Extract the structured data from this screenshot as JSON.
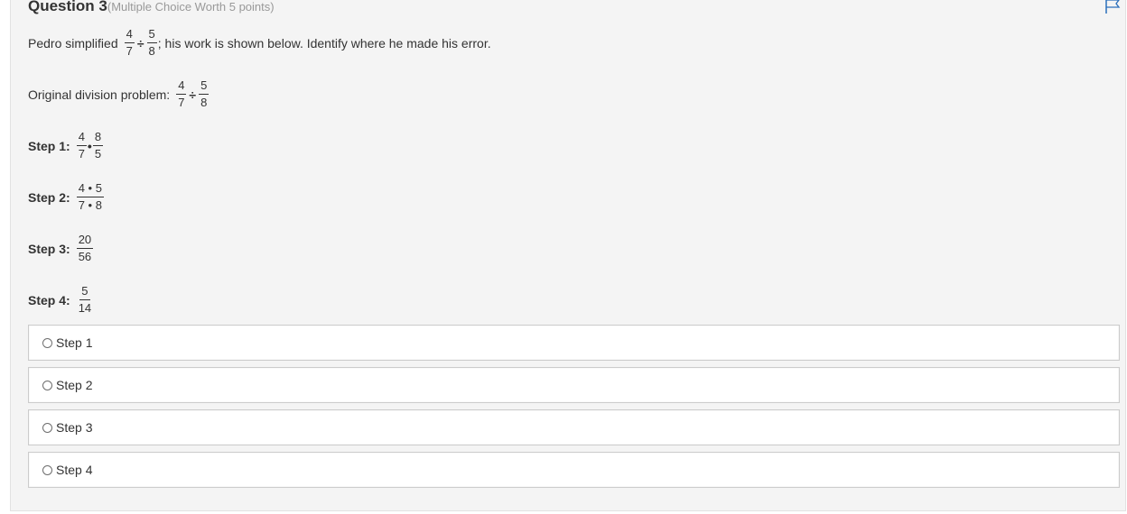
{
  "question": {
    "title": "Question 3",
    "subtitle": "(Multiple Choice Worth 5 points)",
    "flag_icon": "flag-icon"
  },
  "prompt": {
    "lead": "Pedro simplified",
    "frac_a": {
      "num": "4",
      "den": "7"
    },
    "operator": "÷",
    "frac_b": {
      "num": "5",
      "den": "8"
    },
    "tail": "; his work is shown below. Identify where he made his error."
  },
  "original": {
    "label": "Original division problem:",
    "frac_a": {
      "num": "4",
      "den": "7"
    },
    "operator": "÷",
    "frac_b": {
      "num": "5",
      "den": "8"
    }
  },
  "steps": [
    {
      "label": "Step 1:",
      "frac_a": {
        "num": "4",
        "den": "7"
      },
      "operator": "•",
      "frac_b": {
        "num": "8",
        "den": "5"
      }
    },
    {
      "label": "Step 2:",
      "frac": {
        "num": "4 • 5",
        "den": "7 • 8"
      }
    },
    {
      "label": "Step 3:",
      "frac": {
        "num": "20",
        "den": "56"
      }
    },
    {
      "label": "Step 4:",
      "frac": {
        "num": "5",
        "den": "14"
      }
    }
  ],
  "options": [
    {
      "label": "Step 1",
      "selected": false
    },
    {
      "label": "Step 2",
      "selected": false
    },
    {
      "label": "Step 3",
      "selected": false
    },
    {
      "label": "Step 4",
      "selected": false
    }
  ]
}
